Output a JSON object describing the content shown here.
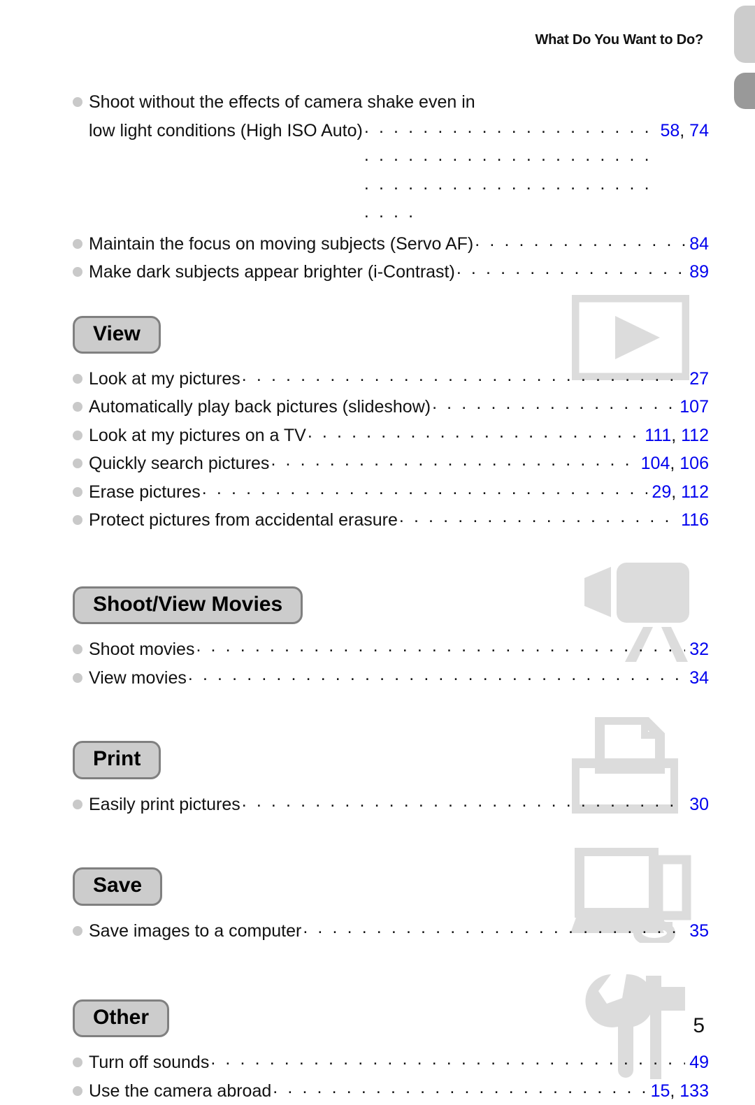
{
  "header": {
    "running_title": "What Do You Want to Do?",
    "folio": "5"
  },
  "intro_entries": [
    {
      "line1": "Shoot without the effects of camera shake even in",
      "line2": "low light conditions (High ISO Auto)",
      "pages": "58, 74"
    },
    {
      "label": "Maintain the focus on moving subjects (Servo AF)",
      "pages": "84"
    },
    {
      "label": "Make dark subjects appear brighter (i-Contrast)",
      "pages": "89"
    }
  ],
  "sections": [
    {
      "title": "View",
      "icon": "play-screen-icon",
      "entries": [
        {
          "label": "Look at my pictures",
          "pages": "27"
        },
        {
          "label": "Automatically play back pictures (slideshow)",
          "pages": "107"
        },
        {
          "label": "Look at my pictures on a TV",
          "pages": "111, 112"
        },
        {
          "label": "Quickly search pictures",
          "pages": "104, 106"
        },
        {
          "label": "Erase pictures",
          "pages": "29, 112"
        },
        {
          "label": "Protect pictures from accidental erasure",
          "pages": "116"
        }
      ]
    },
    {
      "title": "Shoot/View Movies",
      "icon": "camcorder-icon",
      "entries": [
        {
          "label": "Shoot movies",
          "pages": "32"
        },
        {
          "label": "View movies",
          "pages": "34"
        }
      ]
    },
    {
      "title": "Print",
      "icon": "printer-icon",
      "entries": [
        {
          "label": "Easily print pictures",
          "pages": "30"
        }
      ]
    },
    {
      "title": "Save",
      "icon": "computer-icon",
      "entries": [
        {
          "label": "Save images to a computer",
          "pages": "35"
        }
      ]
    },
    {
      "title": "Other",
      "icon": "wrench-hammer-icon",
      "entries": [
        {
          "label": "Turn off sounds",
          "pages": "49"
        },
        {
          "label": "Use the camera abroad",
          "pages": "15, 133"
        }
      ]
    }
  ],
  "colors": {
    "page_number_blue": "#0000ee",
    "badge_fill": "#cccccc",
    "badge_border": "#808080",
    "bullet_gray": "#c9c9c9",
    "watermark_gray": "#dcdcdc",
    "tab_light": "#cccccc",
    "tab_dark": "#999999"
  }
}
